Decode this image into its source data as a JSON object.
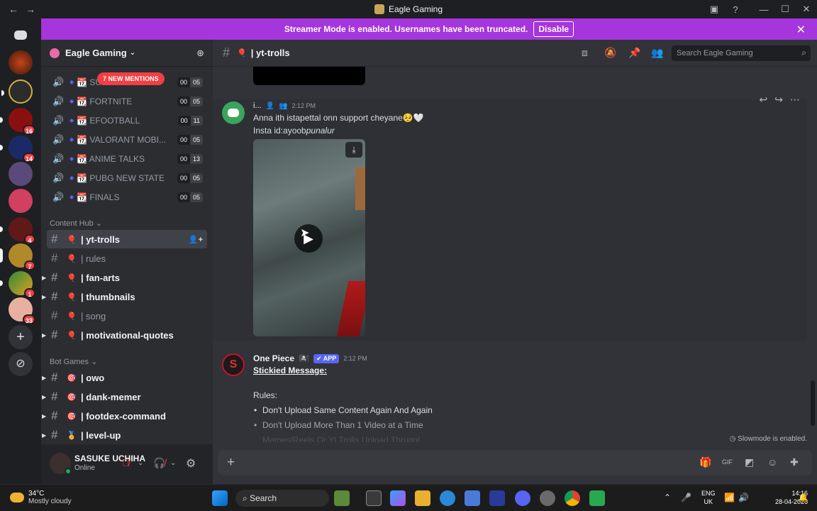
{
  "window": {
    "title": "Eagle Gaming"
  },
  "banner": {
    "text": "Streamer Mode is enabled. Usernames have been truncated.",
    "button": "Disable"
  },
  "servers": {
    "badges": [
      "16",
      "14",
      "4",
      "7",
      "1",
      "33"
    ]
  },
  "guild": {
    "name": "Eagle Gaming",
    "mentions": "7 NEW MENTIONS"
  },
  "voice_channels": [
    {
      "name": "📆 SU",
      "a": "00",
      "b": "05"
    },
    {
      "name": "📆 FORTNITE",
      "a": "00",
      "b": "05"
    },
    {
      "name": "📆 EFOOTBALL",
      "a": "00",
      "b": "11"
    },
    {
      "name": "📆 VALORANT MOBI...",
      "a": "00",
      "b": "05"
    },
    {
      "name": "📆 ANIME TALKS",
      "a": "00",
      "b": "13"
    },
    {
      "name": "📆 PUBG NEW STATE",
      "a": "00",
      "b": "05"
    },
    {
      "name": "📆 FINALS",
      "a": "00",
      "b": "05"
    }
  ],
  "categories": {
    "content_hub": "Content Hub",
    "bot_games": "Bot Games"
  },
  "channels": [
    {
      "name": "| yt-trolls",
      "emoji": "🎈"
    },
    {
      "name": "| rules",
      "emoji": "🎈"
    },
    {
      "name": "| fan-arts",
      "emoji": "🎈"
    },
    {
      "name": "| thumbnails",
      "emoji": "🎈"
    },
    {
      "name": "| song",
      "emoji": "🎈"
    },
    {
      "name": "| motivational-quotes",
      "emoji": "🎈"
    },
    {
      "name": "| owo",
      "emoji": "🎯"
    },
    {
      "name": "| dank-memer",
      "emoji": "🎯"
    },
    {
      "name": "| footdex-command",
      "emoji": "🎯"
    },
    {
      "name": "| level-up",
      "emoji": "🏅"
    }
  ],
  "user": {
    "name": "SASUKE UCHIHA",
    "status": "Online"
  },
  "header": {
    "channel": "| yt-trolls",
    "search_placeholder": "Search Eagle Gaming"
  },
  "message1": {
    "author": "i...",
    "time": "2:12 PM",
    "text": "Anna ith istapettal onn support cheyane🥺🤍",
    "insta_prefix": "Insta id:ayoob",
    "insta_italic": "punalur"
  },
  "message2": {
    "author": "One Piece",
    "tag": "✔ APP",
    "time": "2:12 PM",
    "sticky": "Stickied Message:",
    "rules_title": "Rules:",
    "rules": [
      "Don't Upload Same Content Again And Again",
      "Don't Upload More Than 1 Video at a Time",
      "Memes/Reels Or Yt Trolls Upload Thrugnt"
    ]
  },
  "slowmode": "Slowmode is enabled.",
  "taskbar": {
    "temp": "34°C",
    "weather": "Mostly cloudy",
    "search": "Search",
    "lang1": "ENG",
    "lang2": "UK",
    "time": "14:16",
    "date": "28-04-2026"
  }
}
